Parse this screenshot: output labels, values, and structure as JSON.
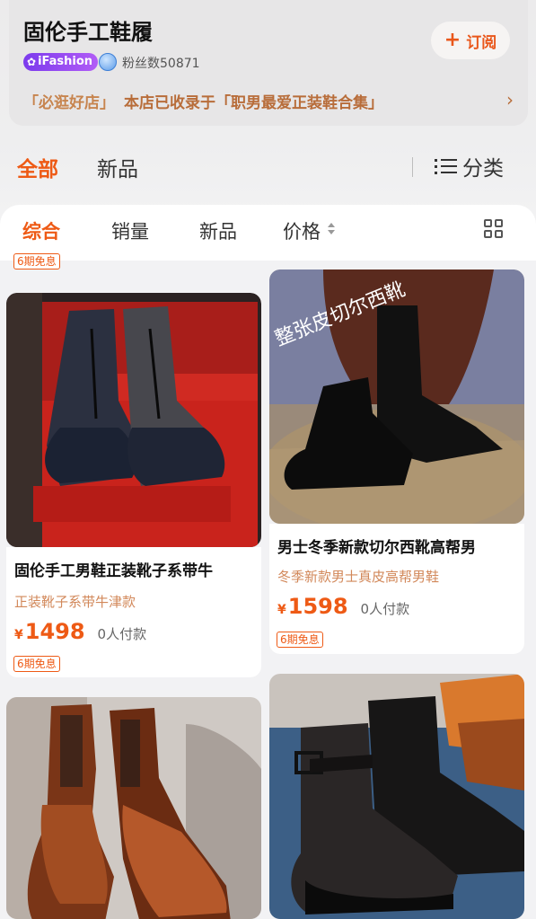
{
  "store": {
    "name": "固伦手工鞋履",
    "badge": "iFashion",
    "fans": "粉丝数50871",
    "subscribe_label": "订阅",
    "promo_tag": "「必逛好店」",
    "promo_text": "本店已收录于「职男最爱正装鞋合集」"
  },
  "top_tabs": {
    "all": "全部",
    "new": "新品",
    "category": "分类"
  },
  "sort_bar": {
    "items": [
      "综合",
      "销量",
      "新品",
      "价格"
    ]
  },
  "installment": "6期免息",
  "products": [
    {
      "title": "固伦手工男鞋正装靴子系带牛",
      "subtitle": "正装靴子系带牛津款",
      "currency": "¥",
      "price": "1498",
      "paid": "0人付款",
      "tag": "6期免息"
    },
    {
      "title": "男士冬季新款切尔西靴高帮男",
      "subtitle": "冬季新款男士真皮高帮男鞋",
      "currency": "¥",
      "price": "1598",
      "paid": "0人付款",
      "tag": "6期免息",
      "image_text": "整张皮切尔西靴"
    }
  ],
  "colors": {
    "accent": "#ee5a15",
    "promo": "#b86d3a",
    "badge": "#8b44f0"
  }
}
